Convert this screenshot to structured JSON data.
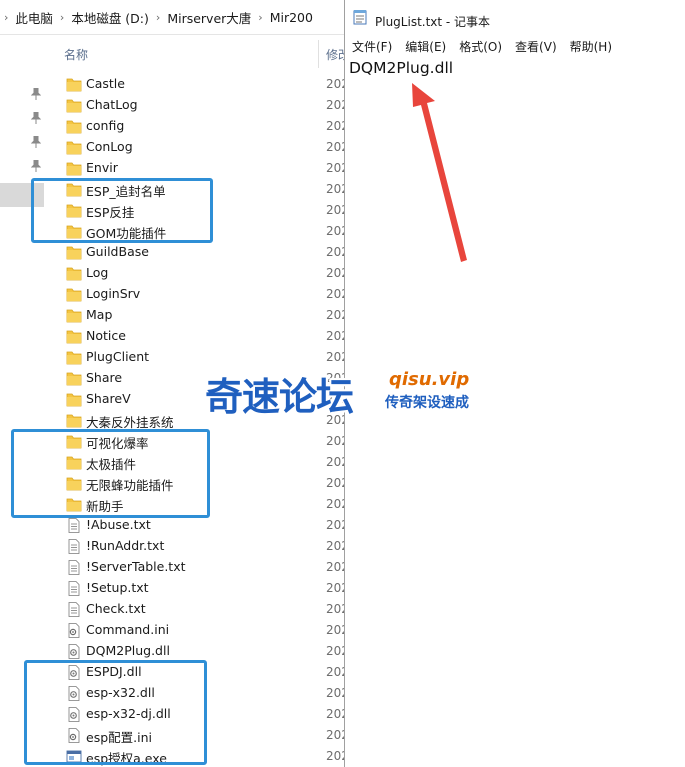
{
  "explorer": {
    "breadcrumb": [
      "此电脑",
      "本地磁盘 (D:)",
      "Mirserver大唐",
      "Mir200"
    ],
    "columns": {
      "name": "名称",
      "modified": "修改"
    },
    "items": [
      {
        "name": "Castle",
        "type": "folder",
        "date": "202"
      },
      {
        "name": "ChatLog",
        "type": "folder",
        "date": "202"
      },
      {
        "name": "config",
        "type": "folder",
        "date": "202"
      },
      {
        "name": "ConLog",
        "type": "folder",
        "date": "202"
      },
      {
        "name": "Envir",
        "type": "folder",
        "date": "202"
      },
      {
        "name": "ESP_追封名单",
        "type": "folder",
        "date": "202"
      },
      {
        "name": "ESP反挂",
        "type": "folder",
        "date": "202"
      },
      {
        "name": "GOM功能插件",
        "type": "folder",
        "date": "202"
      },
      {
        "name": "GuildBase",
        "type": "folder",
        "date": "202"
      },
      {
        "name": "Log",
        "type": "folder",
        "date": "202"
      },
      {
        "name": "LoginSrv",
        "type": "folder",
        "date": "202"
      },
      {
        "name": "Map",
        "type": "folder",
        "date": "202"
      },
      {
        "name": "Notice",
        "type": "folder",
        "date": "202"
      },
      {
        "name": "PlugClient",
        "type": "folder",
        "date": "202"
      },
      {
        "name": "Share",
        "type": "folder",
        "date": "202"
      },
      {
        "name": "ShareV",
        "type": "folder",
        "date": "202"
      },
      {
        "name": "大秦反外挂系统",
        "type": "folder",
        "date": "202"
      },
      {
        "name": "可视化爆率",
        "type": "folder",
        "date": "202"
      },
      {
        "name": "太极插件",
        "type": "folder",
        "date": "202"
      },
      {
        "name": "无限蜂功能插件",
        "type": "folder",
        "date": "202"
      },
      {
        "name": "新助手",
        "type": "folder",
        "date": "202"
      },
      {
        "name": "!Abuse.txt",
        "type": "txt",
        "date": "202"
      },
      {
        "name": "!RunAddr.txt",
        "type": "txt",
        "date": "202"
      },
      {
        "name": "!ServerTable.txt",
        "type": "txt",
        "date": "202"
      },
      {
        "name": "!Setup.txt",
        "type": "txt",
        "date": "202"
      },
      {
        "name": "Check.txt",
        "type": "txt",
        "date": "202"
      },
      {
        "name": "Command.ini",
        "type": "ini",
        "date": "202"
      },
      {
        "name": "DQM2Plug.dll",
        "type": "dll",
        "date": "202"
      },
      {
        "name": "ESPDJ.dll",
        "type": "dll",
        "date": "202"
      },
      {
        "name": "esp-x32.dll",
        "type": "dll",
        "date": "202"
      },
      {
        "name": "esp-x32-dj.dll",
        "type": "dll",
        "date": "202"
      },
      {
        "name": "esp配置.ini",
        "type": "ini",
        "date": "202"
      },
      {
        "name": "esp授权a.exe",
        "type": "exe",
        "date": "202"
      }
    ]
  },
  "notepad": {
    "title": "PlugList.txt - 记事本",
    "menu": [
      "文件(F)",
      "编辑(E)",
      "格式(O)",
      "查看(V)",
      "帮助(H)"
    ],
    "content": "DQM2Plug.dll"
  },
  "watermark": {
    "main": "奇速论坛",
    "domain": "qisu.vip",
    "slogan": "传奇架设速成"
  },
  "colors": {
    "highlight_box": "#2f8fd6",
    "arrow": "#e8453c",
    "folder": "#f4c542",
    "watermark_blue": "#1f5fbf",
    "watermark_orange": "#e06a00"
  }
}
